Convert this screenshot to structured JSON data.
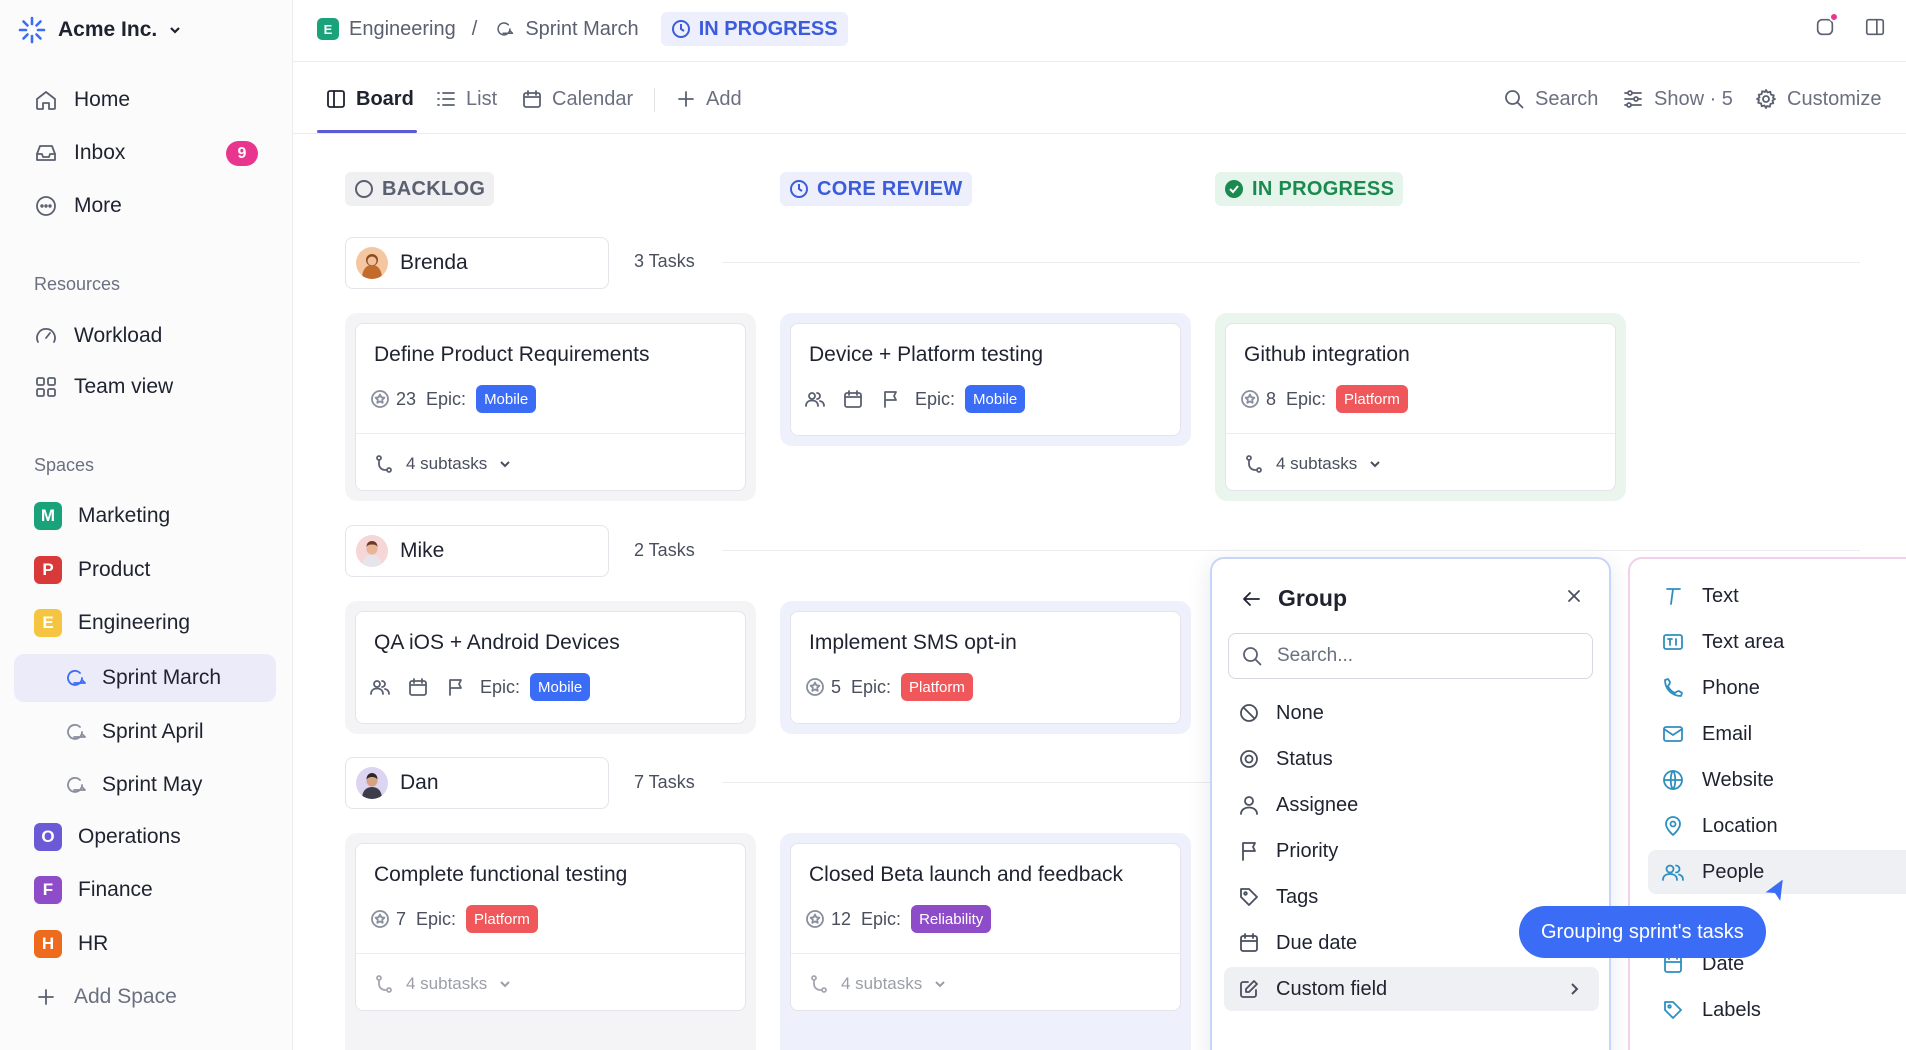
{
  "workspace": {
    "name": "Acme Inc."
  },
  "sidebar": {
    "nav": [
      {
        "label": "Home"
      },
      {
        "label": "Inbox",
        "badge": "9"
      },
      {
        "label": "More"
      }
    ],
    "resources_title": "Resources",
    "resources": [
      {
        "label": "Workload"
      },
      {
        "label": "Team view"
      }
    ],
    "spaces_title": "Spaces",
    "spaces": [
      {
        "label": "Marketing",
        "letter": "M",
        "color": "#1aa37a"
      },
      {
        "label": "Product",
        "letter": "P",
        "color": "#d83a3a"
      },
      {
        "label": "Engineering",
        "letter": "E",
        "color": "#f5c542"
      }
    ],
    "sprints": [
      {
        "label": "Sprint March"
      },
      {
        "label": "Sprint April"
      },
      {
        "label": "Sprint May"
      }
    ],
    "spaces_more": [
      {
        "label": "Operations",
        "letter": "O",
        "color": "#6a5ad6"
      },
      {
        "label": "Finance",
        "letter": "F",
        "color": "#8e4cc9"
      },
      {
        "label": "HR",
        "letter": "H",
        "color": "#ee6b1e"
      }
    ],
    "add_space": "Add Space"
  },
  "breadcrumb": {
    "space": "Engineering",
    "space_letter": "E",
    "separator": "/",
    "sprint": "Sprint March",
    "status": "IN PROGRESS"
  },
  "views": {
    "tabs": [
      {
        "label": "Board"
      },
      {
        "label": "List"
      },
      {
        "label": "Calendar"
      }
    ],
    "add": "Add",
    "search": "Search",
    "show": "Show · 5",
    "customize": "Customize"
  },
  "columns": [
    {
      "label": "BACKLOG",
      "color": "#5b6070",
      "bg": "#f0f0f3"
    },
    {
      "label": "CORE REVIEW",
      "color": "#3c5cdc",
      "bg": "#edf0fc"
    },
    {
      "label": "IN PROGRESS",
      "color": "#1a8a4e",
      "bg": "#e6f5ec"
    }
  ],
  "groups": [
    {
      "name": "Brenda",
      "count": "3 Tasks",
      "cards": [
        {
          "title": "Define Product Requirements",
          "points": "23",
          "epic_label": "Epic:",
          "tag": "Mobile",
          "tag_color": "#3b6cf6",
          "subtasks": "4 subtasks"
        },
        {
          "title": "Device + Platform testing",
          "epic_label": "Epic:",
          "tag": "Mobile",
          "tag_color": "#3b6cf6"
        },
        {
          "title": "Github integration",
          "points": "8",
          "epic_label": "Epic:",
          "tag": "Platform",
          "tag_color": "#f0575a",
          "subtasks": "4 subtasks"
        }
      ]
    },
    {
      "name": "Mike",
      "count": "2 Tasks",
      "cards": [
        {
          "title": "QA iOS + Android Devices",
          "epic_label": "Epic:",
          "tag": "Mobile",
          "tag_color": "#3b6cf6"
        },
        {
          "title": "Implement SMS opt-in",
          "points": "5",
          "epic_label": "Epic:",
          "tag": "Platform",
          "tag_color": "#f0575a"
        }
      ]
    },
    {
      "name": "Dan",
      "count": "7 Tasks",
      "cards": [
        {
          "title": "Complete functional testing",
          "points": "7",
          "epic_label": "Epic:",
          "tag": "Platform",
          "tag_color": "#f0575a",
          "subtasks": "4 subtasks"
        },
        {
          "title": "Closed Beta launch and feedback",
          "points": "12",
          "epic_label": "Epic:",
          "tag": "Reliability",
          "tag_color": "#8e4cc9",
          "subtasks": "4 subtasks"
        }
      ]
    }
  ],
  "group_popover": {
    "title": "Group",
    "search_placeholder": "Search...",
    "items": [
      {
        "label": "None"
      },
      {
        "label": "Status"
      },
      {
        "label": "Assignee"
      },
      {
        "label": "Priority"
      },
      {
        "label": "Tags"
      },
      {
        "label": "Due date"
      },
      {
        "label": "Custom field"
      }
    ]
  },
  "field_popover": {
    "items": [
      {
        "label": "Text"
      },
      {
        "label": "Text area"
      },
      {
        "label": "Phone"
      },
      {
        "label": "Email"
      },
      {
        "label": "Website"
      },
      {
        "label": "Location"
      },
      {
        "label": "People"
      },
      {
        "label": "Date"
      },
      {
        "label": "Labels"
      }
    ]
  },
  "tooltip": "Grouping sprint's tasks"
}
